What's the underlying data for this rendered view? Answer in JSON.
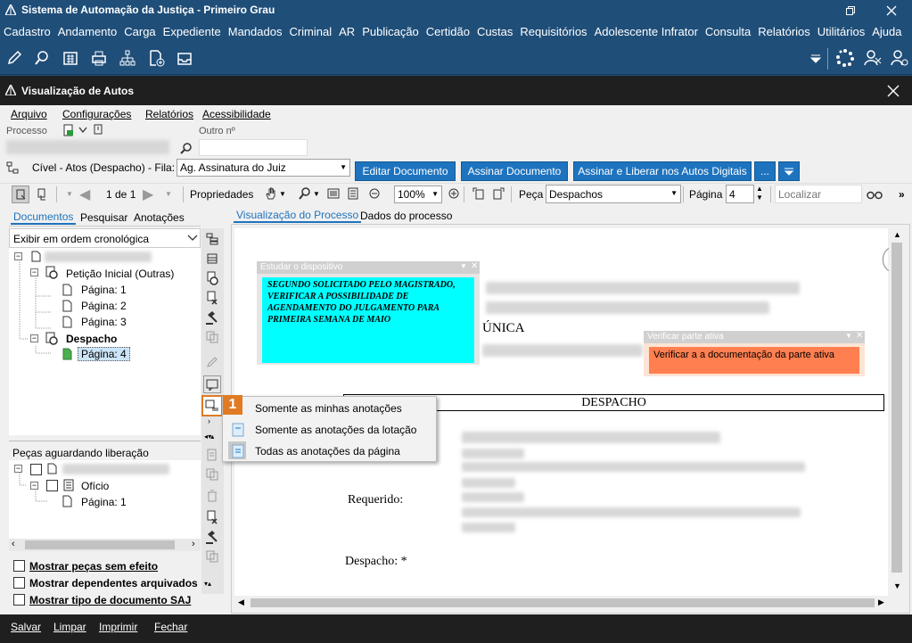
{
  "window": {
    "title": "Sistema de Automação da Justiça - Primeiro Grau"
  },
  "menubar": [
    "Cadastro",
    "Andamento",
    "Carga",
    "Expediente",
    "Mandados",
    "Criminal",
    "AR",
    "Publicação",
    "Certidão",
    "Custas",
    "Requisitórios",
    "Adolescente Infrator",
    "Consulta",
    "Relatórios",
    "Utilitários",
    "Ajuda"
  ],
  "subwindow": {
    "title": "Visualização de Autos",
    "menu": [
      "Arquivo",
      "Configurações",
      "Relatórios",
      "Acessibilidade"
    ],
    "processo_label": "Processo",
    "outro_label": "Outro nº",
    "fila_label": "Cível - Atos (Despacho) - Fila:",
    "fila_value": "Ag. Assinatura do Juiz",
    "buttons": {
      "editar": "Editar Documento",
      "assinar": "Assinar Documento",
      "assinar_liberar": "Assinar e Liberar nos Autos Digitais",
      "mais": "..."
    }
  },
  "toolbar": {
    "page_indicator": "1 de 1",
    "propriedades": "Propriedades",
    "zoom": "100%",
    "peca_label": "Peça",
    "peca_value": "Despachos",
    "pagina_label": "Página",
    "pagina_value": "4",
    "localizar_placeholder": "Localizar"
  },
  "left_panel": {
    "tabs": [
      "Documentos",
      "Pesquisar",
      "Anotações"
    ],
    "order": "Exibir em ordem cronológica",
    "tree": {
      "peticao": "Petição Inicial (Outras)",
      "paginas": [
        "Página: 1",
        "Página: 2",
        "Página: 3"
      ],
      "despacho": "Despacho",
      "despacho_pagina": "Página: 4"
    },
    "pecas_title": "Peças aguardando liberação",
    "pecas_tree": {
      "oficio": "Ofício",
      "pagina": "Página: 1"
    },
    "checkboxes": [
      "Mostrar peças sem efeito",
      "Mostrar dependentes arquivados",
      "Mostrar tipo de documento SAJ"
    ]
  },
  "viewer": {
    "tabs": [
      "Visualização do Processo",
      "Dados do processo"
    ],
    "note1": {
      "title": "Estudar o dispositivo",
      "text": "SEGUNDO SOLICITADO PELO MAGISTRADO, VERIFICAR A POSSIBILIDADE DE AGENDAMENTO DO JULGAMENTO PARA PRIMEIRA SEMANA DE MAIO"
    },
    "note2": {
      "title": "Verificar parte ativa",
      "text": "Verificar a a documentação da parte ativa"
    },
    "doc": {
      "unica": "ÚNICA",
      "despacho_header": "DESPACHO",
      "requerido": "Requerido:",
      "despacho_label": "Despacho: *"
    }
  },
  "context_menu": {
    "badge": "1",
    "items": [
      "Somente as minhas anotações",
      "Somente as anotações da lotação",
      "Todas as anotações da página"
    ]
  },
  "bottom": [
    "Salvar",
    "Limpar",
    "Imprimir",
    "Fechar"
  ],
  "colors": {
    "titlebar": "#1f4e79",
    "accent": "#1e73be",
    "note_cyan": "#00ffff",
    "note_orange": "#ff7f50",
    "badge": "#e07b24"
  }
}
